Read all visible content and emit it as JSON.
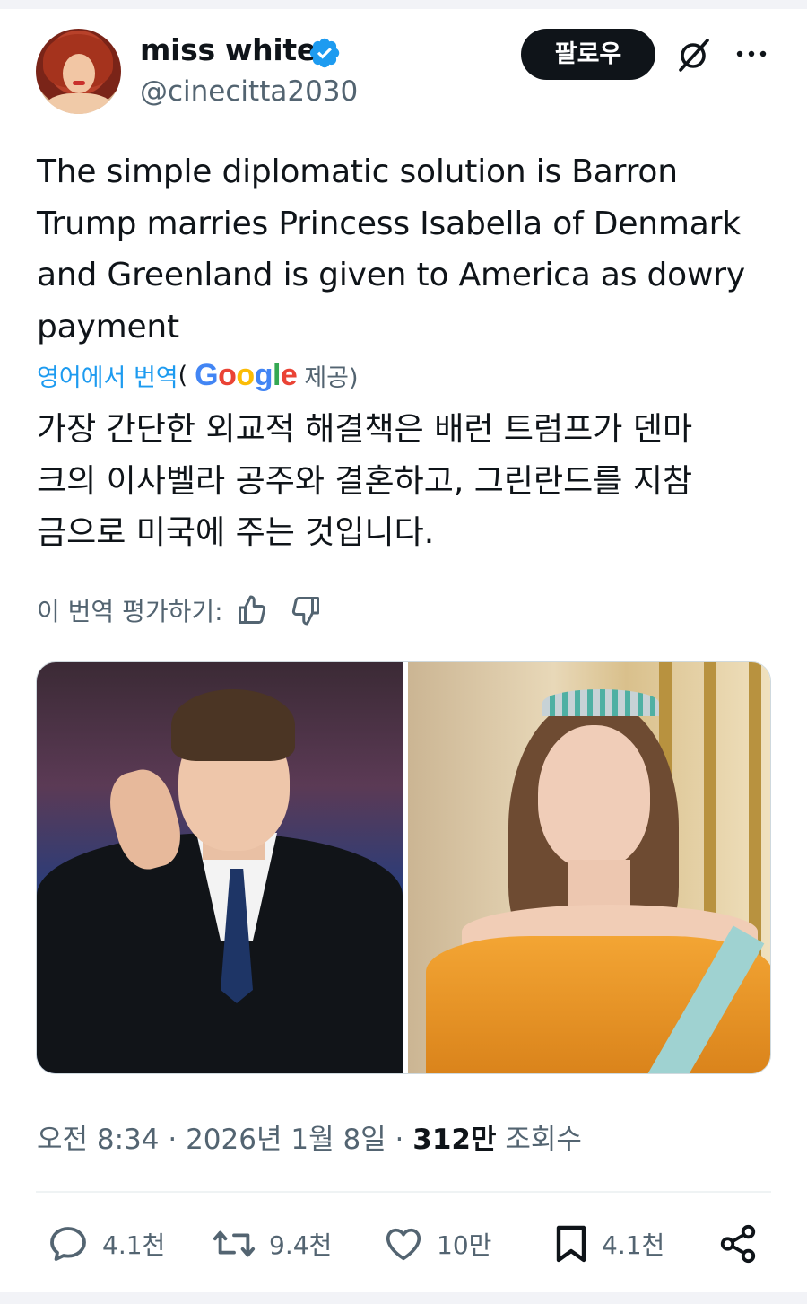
{
  "author": {
    "name": "miss white",
    "handle": "@cinecitta2030",
    "verified": true
  },
  "header": {
    "follow_label": "팔로우"
  },
  "tweet": {
    "text_lines": [
      "The simple diplomatic solution is Barron",
      "Trump marries Princess Isabella of Denmark",
      "and Greenland is given to America as dowry",
      "payment"
    ],
    "translate": {
      "link_label": "영어에서 번역",
      "open_paren": "(",
      "provider": "Google",
      "provided_label": "제공)"
    },
    "translated_lines": [
      "가장 간단한 외교적 해결책은 배런 트럼프가 덴마",
      "크의 이사벨라 공주와 결혼하고, 그린란드를 지참",
      "금으로 미국에 주는 것입니다."
    ],
    "rate_label": "이 번역 평가하기:"
  },
  "meta": {
    "time": "오전 8:34",
    "sep1": " · ",
    "date": "2026년 1월 8일",
    "sep2": " · ",
    "views_count": "312만",
    "views_label": " 조회수"
  },
  "actions": {
    "replies": "4.1천",
    "retweets": "9.4천",
    "likes": "10만",
    "bookmarks": "4.1천"
  },
  "colors": {
    "accent": "#1d9bf0",
    "text_primary": "#0f1419",
    "text_secondary": "#536471",
    "follow_bg": "#0f1419"
  },
  "icons": [
    "verified-badge-icon",
    "grok-icon",
    "more-icon",
    "thumbs-up-icon",
    "thumbs-down-icon",
    "reply-icon",
    "retweet-icon",
    "like-icon",
    "bookmark-icon",
    "share-icon"
  ]
}
